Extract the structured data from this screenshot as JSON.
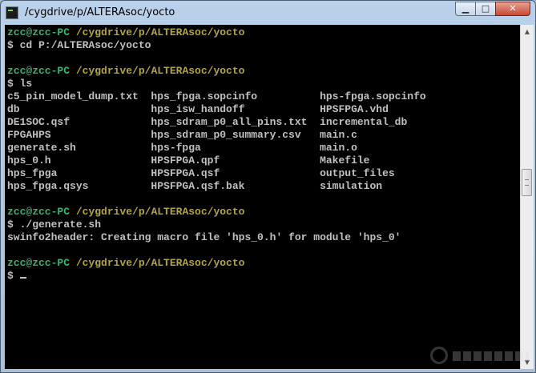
{
  "window": {
    "title": "/cygdrive/p/ALTERAsoc/yocto",
    "controls": {
      "minimize": "▁",
      "maximize": "□",
      "close": "✕"
    }
  },
  "terminal": {
    "lines": [
      {
        "segments": [
          {
            "text": "zcc@zcc-PC ",
            "style": "ok"
          },
          {
            "text": "/cygdrive/p/ALTERAsoc/yocto",
            "style": "ok2"
          }
        ]
      },
      {
        "segments": [
          {
            "text": "$ cd P:/ALTERAsoc/yocto",
            "style": ""
          }
        ]
      },
      {
        "segments": [
          {
            "text": "",
            "style": ""
          }
        ]
      },
      {
        "segments": [
          {
            "text": "zcc@zcc-PC ",
            "style": "ok"
          },
          {
            "text": "/cygdrive/p/ALTERAsoc/yocto",
            "style": "ok2"
          }
        ]
      },
      {
        "segments": [
          {
            "text": "$ ls",
            "style": ""
          }
        ]
      },
      {
        "segments": [
          {
            "text": "c5_pin_model_dump.txt  hps_fpga.sopcinfo          hps-fpga.sopcinfo",
            "style": ""
          }
        ]
      },
      {
        "segments": [
          {
            "text": "db                     hps_isw_handoff            HPSFPGA.vhd",
            "style": ""
          }
        ]
      },
      {
        "segments": [
          {
            "text": "DE1SOC.qsf             hps_sdram_p0_all_pins.txt  incremental_db",
            "style": ""
          }
        ]
      },
      {
        "segments": [
          {
            "text": "FPGAHPS                hps_sdram_p0_summary.csv   main.c",
            "style": ""
          }
        ]
      },
      {
        "segments": [
          {
            "text": "generate.sh            hps-fpga                   main.o",
            "style": ""
          }
        ]
      },
      {
        "segments": [
          {
            "text": "hps_0.h                HPSFPGA.qpf                Makefile",
            "style": ""
          }
        ]
      },
      {
        "segments": [
          {
            "text": "hps_fpga               HPSFPGA.qsf                output_files",
            "style": ""
          }
        ]
      },
      {
        "segments": [
          {
            "text": "hps_fpga.qsys          HPSFPGA.qsf.bak            simulation",
            "style": ""
          }
        ]
      },
      {
        "segments": [
          {
            "text": "",
            "style": ""
          }
        ]
      },
      {
        "segments": [
          {
            "text": "zcc@zcc-PC ",
            "style": "ok"
          },
          {
            "text": "/cygdrive/p/ALTERAsoc/yocto",
            "style": "ok2"
          }
        ]
      },
      {
        "segments": [
          {
            "text": "$ ./generate.sh",
            "style": ""
          }
        ]
      },
      {
        "segments": [
          {
            "text": "swinfo2header: Creating macro file 'hps_0.h' for module 'hps_0'",
            "style": ""
          }
        ]
      },
      {
        "segments": [
          {
            "text": "",
            "style": ""
          }
        ]
      },
      {
        "segments": [
          {
            "text": "zcc@zcc-PC ",
            "style": "ok"
          },
          {
            "text": "/cygdrive/p/ALTERAsoc/yocto",
            "style": "ok2"
          }
        ]
      },
      {
        "segments": [
          {
            "text": "$",
            "style": ""
          }
        ]
      }
    ]
  },
  "scrollbar": {
    "up_icon": "▲",
    "down_icon": "▼",
    "thumb_position": 0.45
  },
  "colors": {
    "prompt_user": "#3ab26b",
    "prompt_path": "#b3a53b",
    "text": "#c0c0c0",
    "background": "#000000"
  }
}
